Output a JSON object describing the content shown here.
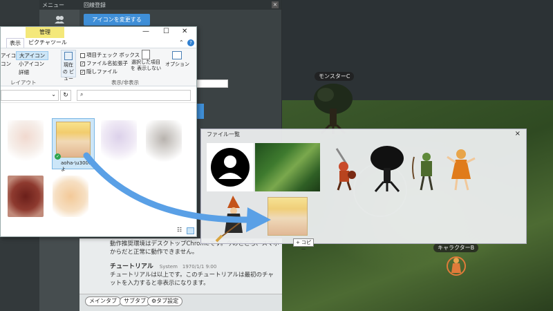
{
  "sidebar": {
    "header": "メニュー"
  },
  "chat_panel": {
    "title": "回線登録",
    "change_icon_button": "アイコンを変更する",
    "messages": [
      {
        "text": "動作推奨環境はデスクトップChromeです。今のところ、スマホからだと正常に動作できません。"
      },
      {
        "name": "チュートリアル",
        "meta": "System　1970/1/1 9:00",
        "text": "チュートリアルは以上です。このチュートリアルは最初のチャットを入力すると非表示になります。"
      }
    ],
    "tabs": {
      "main": "メインタブ",
      "sub": "サブタブ",
      "settings": "タブ設定"
    }
  },
  "explorer": {
    "context_tab": "管理",
    "tabs": {
      "view": "表示",
      "picture_tools": "ピクチャツール"
    },
    "layout": {
      "options": [
        "アイコン",
        "大アイコン",
        "コン",
        "小アイコン",
        "詳細"
      ],
      "group_label": "レイアウト"
    },
    "current_view": "現在の ビュー",
    "show_hide": {
      "item_checkboxes": "項目チェック ボックス",
      "file_extensions": "ファイル名拡張子",
      "hidden_files": "隠しファイル",
      "hide_selected": "選択した項目を 表示しない",
      "options": "オプション",
      "group_label": "表示/非表示"
    },
    "window_controls": {
      "minimize": "—",
      "maximize": "☐",
      "close": "✕",
      "help": "?"
    },
    "refresh": "↻",
    "selected_file_caption": "aoha-\\u3000よ"
  },
  "file_list": {
    "title": "ファイル一覧",
    "close": "×",
    "copy_hint": "+ コピー"
  },
  "map": {
    "labels": {
      "monster_c": "モンスターC",
      "character_b": "キャラクターB"
    }
  },
  "colors": {
    "accent_blue": "#3f8fd8",
    "manage_tab": "#f4e87a",
    "drag_arrow": "#5aa0e6"
  }
}
